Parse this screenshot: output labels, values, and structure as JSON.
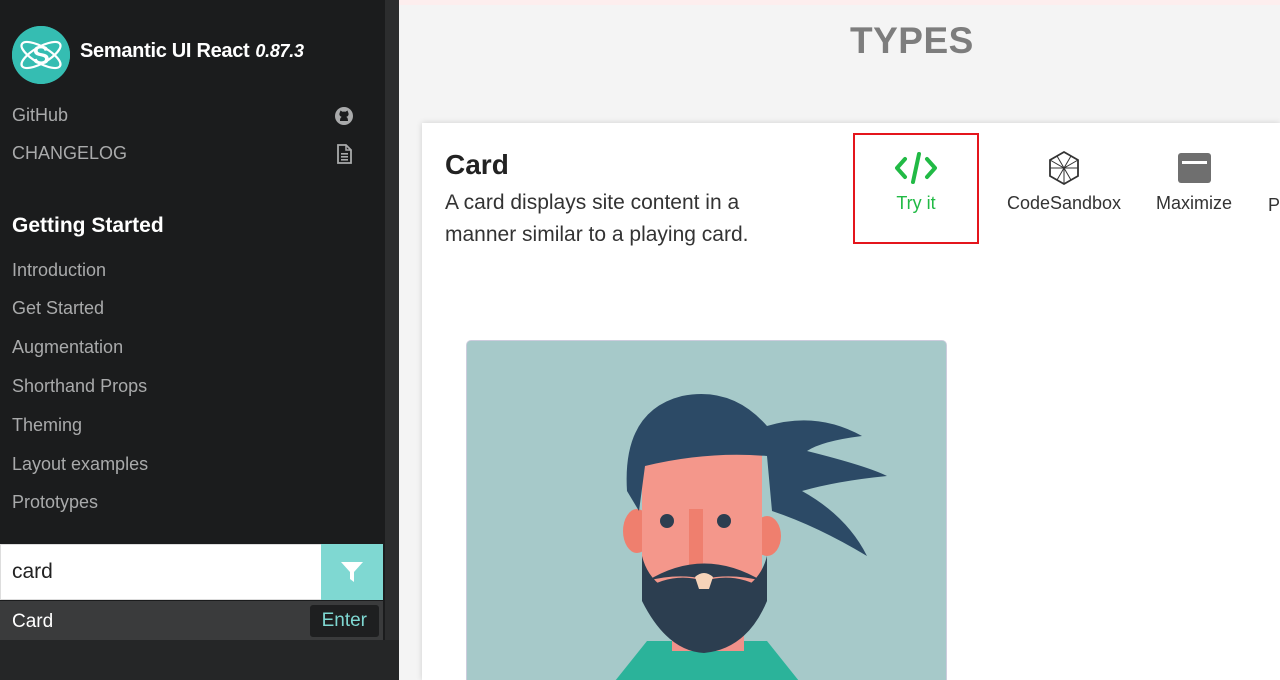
{
  "brand": {
    "name": "Semantic UI React",
    "version": "0.87.3"
  },
  "sidebar": {
    "links": [
      {
        "label": "GitHub",
        "icon": "github-icon"
      },
      {
        "label": "CHANGELOG",
        "icon": "file-icon"
      }
    ],
    "section": "Getting Started",
    "items": [
      "Introduction",
      "Get Started",
      "Augmentation",
      "Shorthand Props",
      "Theming",
      "Layout examples",
      "Prototypes"
    ],
    "search": {
      "value": "card"
    },
    "result": {
      "label": "Card",
      "hint": "Enter"
    }
  },
  "main": {
    "section_title": "TYPES",
    "example": {
      "title": "Card",
      "description": "A card displays site content in a manner similar to a playing card."
    },
    "tools": {
      "try_it": "Try it",
      "codesandbox": "CodeSandbox",
      "maximize": "Maximize",
      "partial": "P"
    }
  },
  "colors": {
    "sidebar_bg": "#1b1c1d",
    "teal": "#35bdb2",
    "search_btn": "#7fd8d2",
    "try_it_green": "#21ba45",
    "highlight_red": "#e4151c"
  }
}
